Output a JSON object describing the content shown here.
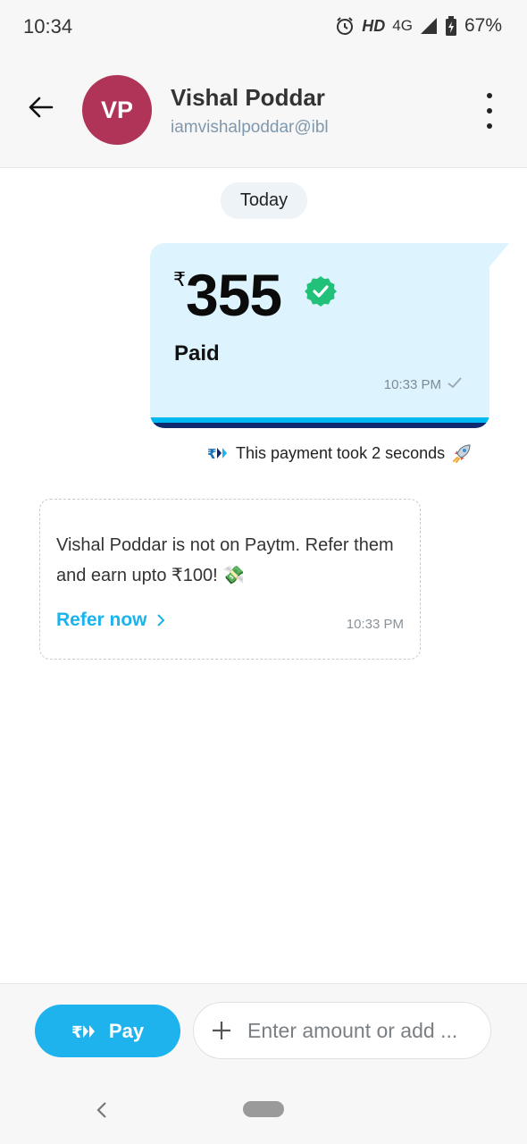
{
  "status_bar": {
    "time": "10:34",
    "hd_label": "HD",
    "network_label": "4G",
    "battery_percent": "67%",
    "icons": [
      "alarm-icon",
      "signal-icon",
      "battery-icon"
    ]
  },
  "header": {
    "avatar_initials": "VP",
    "avatar_color": "#b03458",
    "contact_name": "Vishal Poddar",
    "contact_vpa": "iamvishalpoddar@ibl",
    "icons": [
      "back-arrow-icon",
      "more-options-icon"
    ]
  },
  "chat": {
    "date_chip": "Today",
    "payment": {
      "currency_symbol": "₹",
      "amount": "355",
      "status": "Paid",
      "time": "10:33 PM",
      "icons": [
        "verified-check-icon",
        "sent-tick-icon"
      ]
    },
    "speed_note": {
      "text": "This payment took 2 seconds",
      "icons": [
        "upi-icon",
        "rocket-icon"
      ]
    },
    "refer_card": {
      "message": "Vishal Poddar is not on Paytm. Refer them and earn upto ₹100!",
      "emoji": "💸",
      "link_label": "Refer now",
      "time": "10:33 PM",
      "icons": [
        "chevron-right-icon"
      ]
    }
  },
  "bottom_bar": {
    "pay_label": "Pay",
    "input_placeholder": "Enter amount or add ...",
    "icons": [
      "upi-icon",
      "plus-icon"
    ]
  },
  "system_nav": {
    "icons": [
      "nav-back-icon",
      "home-pill-icon"
    ]
  },
  "colors": {
    "accent": "#1fb3ee",
    "payment_bubble": "#ddf3fd",
    "verified_green": "#21c17a",
    "stripe_dark": "#0f2a6e"
  }
}
